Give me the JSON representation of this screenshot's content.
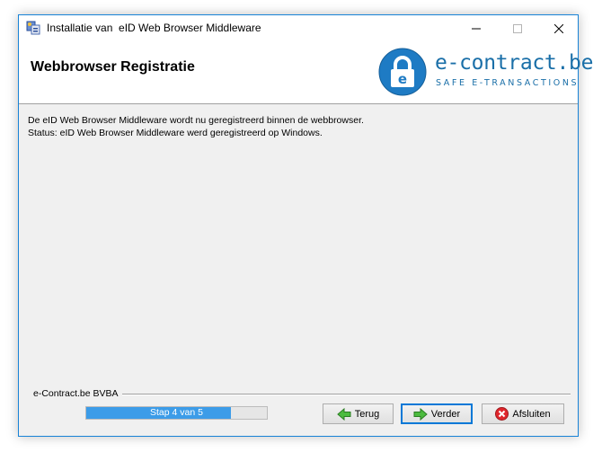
{
  "window": {
    "title": "Installatie van  eID Web Browser Middleware"
  },
  "header": {
    "title": "Webbrowser Registratie",
    "logo": {
      "word": "e-contract.be",
      "tagline": "SAFE E-TRANSACTIONS",
      "lock_letter": "e"
    }
  },
  "content": {
    "lines": [
      "De eID Web Browser Middleware wordt nu geregistreerd binnen de webbrowser.",
      "Status: eID Web Browser Middleware werd geregistreerd op Windows."
    ]
  },
  "footer": {
    "company": "e-Contract.be BVBA",
    "progress": {
      "label": "Stap 4 van 5",
      "current": 4,
      "total": 5
    },
    "buttons": {
      "back": "Terug",
      "next": "Verder",
      "close": "Afsluiten"
    }
  },
  "colors": {
    "window_border": "#1883d7",
    "logo_blue": "#1a6fa8",
    "progress_fill": "#3c9ce8",
    "back_arrow": "#3aa83a",
    "close_icon": "#d9262c"
  },
  "icons": {
    "app": "installer-icon",
    "minimize": "minimize-icon",
    "maximize": "maximize-icon",
    "close": "close-icon",
    "back": "arrow-left-icon",
    "next": "arrow-right-icon",
    "exit": "cancel-icon"
  }
}
